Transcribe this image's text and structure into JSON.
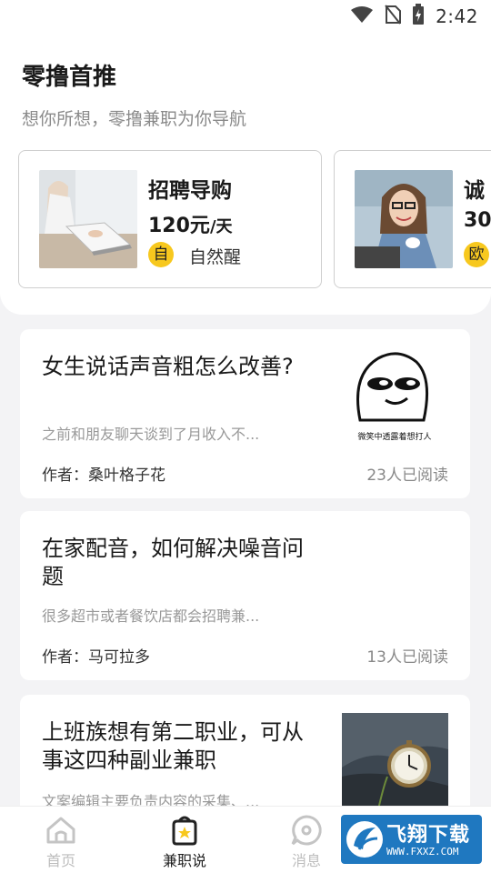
{
  "status_bar": {
    "time": "2:42"
  },
  "header": {
    "title": "零撸首推",
    "subtitle": "想你所想，零撸兼职为你导航"
  },
  "jobs": [
    {
      "title": "招聘导购",
      "salary": "120元",
      "unit": "/天",
      "tag": "自",
      "company": "自然醒"
    },
    {
      "title": "诚",
      "salary": "30",
      "unit": "",
      "tag": "欧",
      "company": ""
    }
  ],
  "articles": [
    {
      "title": "女生说话声音粗怎么改善?",
      "excerpt": "之前和朋友聊天谈到了月收入不...",
      "author": "作者：桑叶格子花",
      "reads": "23人已阅读",
      "thumb_caption": "微笑中透露着想打人"
    },
    {
      "title": "在家配音，如何解决噪音问题",
      "excerpt": "很多超市或者餐饮店都会招聘兼...",
      "author": "作者：马可拉多",
      "reads": "13人已阅读"
    },
    {
      "title": "上班族想有第二职业，可从事这四种副业兼职",
      "excerpt": "文案编辑主要负责内容的采集、..."
    }
  ],
  "bottom_nav": [
    {
      "label": "首页",
      "icon": "home-icon",
      "active": false
    },
    {
      "label": "兼职说",
      "icon": "star-bag-icon",
      "active": true
    },
    {
      "label": "消息",
      "icon": "message-icon",
      "active": false
    }
  ],
  "watermark": {
    "text": "飞翔下载",
    "url": "WWW.FXXZ.COM"
  },
  "colors": {
    "accent": "#f7c81e",
    "background": "#f3f3f5",
    "watermark": "#1f78c0"
  }
}
